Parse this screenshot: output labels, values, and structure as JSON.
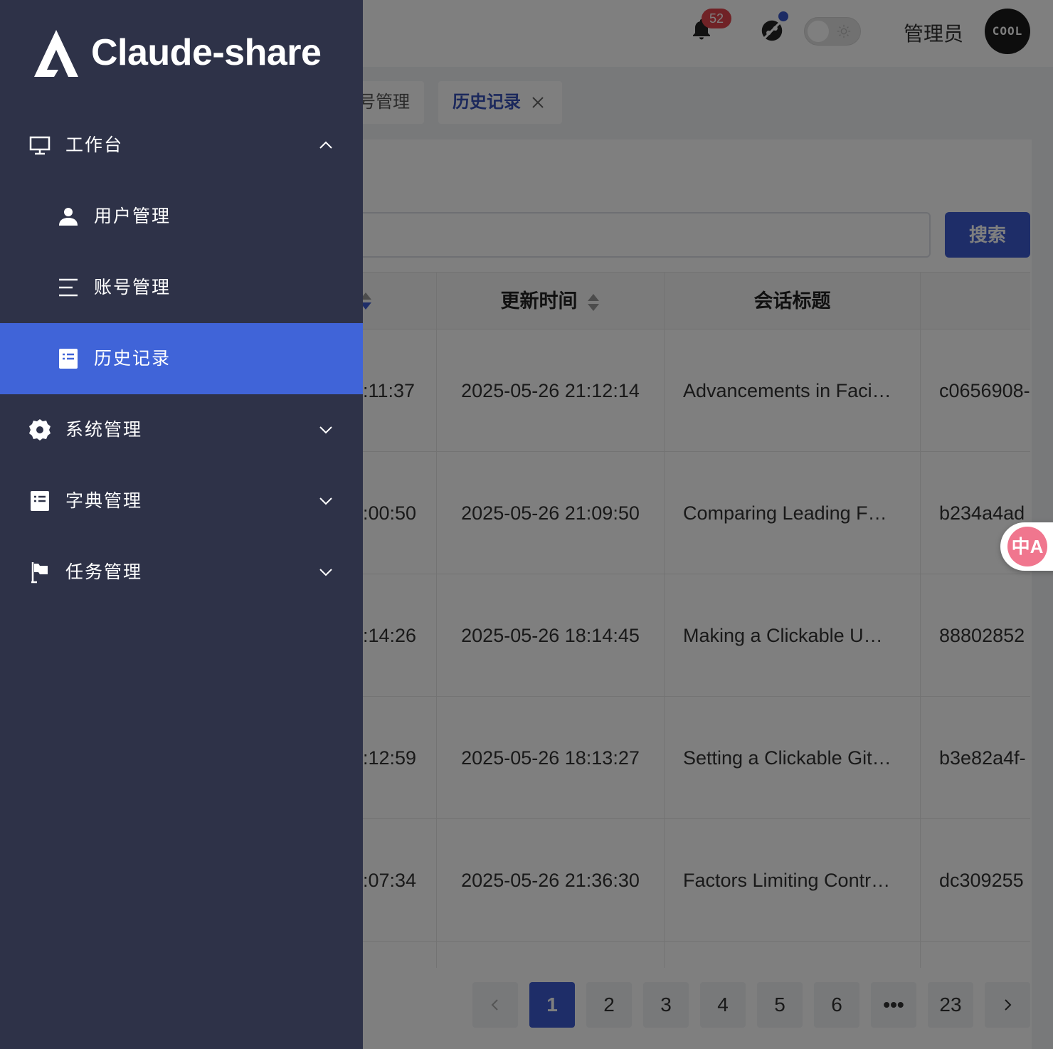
{
  "header": {
    "notification_count": "52",
    "user_name": "管理员",
    "avatar_text": "COOL"
  },
  "tabs": [
    {
      "label": "号管理"
    },
    {
      "label": "历史记录"
    }
  ],
  "search": {
    "button_label": "搜索"
  },
  "table": {
    "columns": [
      "",
      "更新时间",
      "会话标题",
      ""
    ],
    "rows": [
      {
        "created": ":11:37",
        "updated": "2025-05-26 21:12:14",
        "title": "Advancements in Faci…",
        "id": "c0656908-"
      },
      {
        "created": ":00:50",
        "updated": "2025-05-26 21:09:50",
        "title": "Comparing Leading F…",
        "id": "b234a4ad"
      },
      {
        "created": ":14:26",
        "updated": "2025-05-26 18:14:45",
        "title": "Making a Clickable U…",
        "id": "88802852"
      },
      {
        "created": ":12:59",
        "updated": "2025-05-26 18:13:27",
        "title": "Setting a Clickable Git…",
        "id": "b3e82a4f-"
      },
      {
        "created": ":07:34",
        "updated": "2025-05-26 21:36:30",
        "title": "Factors Limiting Contr…",
        "id": "dc309255"
      }
    ]
  },
  "pagination": {
    "pages": [
      "1",
      "2",
      "3",
      "4",
      "5",
      "6",
      "•••",
      "23"
    ],
    "current": "1"
  },
  "translate_fab": {
    "text": "中A"
  },
  "sidebar": {
    "brand": "Claude-share",
    "menu": [
      {
        "label": "工作台",
        "icon": "monitor-icon",
        "expanded": true
      },
      {
        "label": "用户管理",
        "icon": "user-icon"
      },
      {
        "label": "账号管理",
        "icon": "list-icon"
      },
      {
        "label": "历史记录",
        "icon": "document-icon",
        "active": true
      },
      {
        "label": "系统管理",
        "icon": "gear-icon"
      },
      {
        "label": "字典管理",
        "icon": "document-icon"
      },
      {
        "label": "任务管理",
        "icon": "flag-icon"
      }
    ]
  },
  "colors": {
    "sidebar_bg": "#2e3248",
    "active_bg": "#4064d8",
    "primary": "#3d5bd1",
    "badge": "#e0454c"
  }
}
